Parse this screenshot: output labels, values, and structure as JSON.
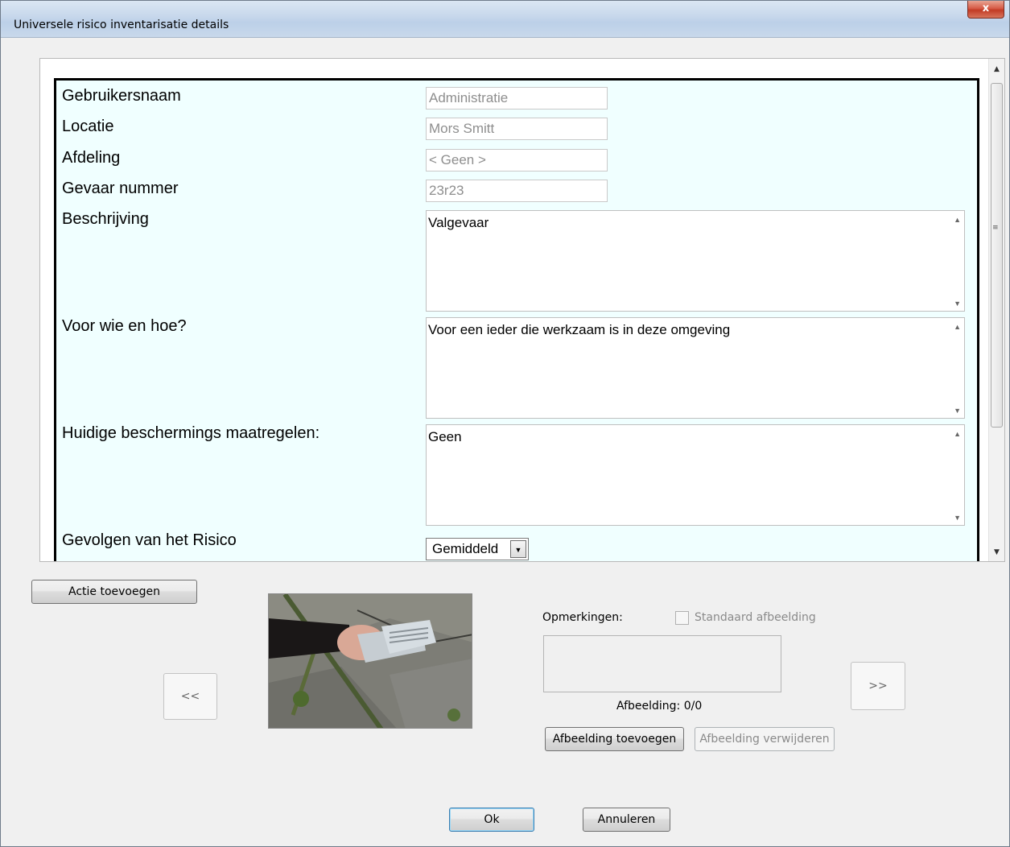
{
  "window": {
    "title": "Universele risico inventarisatie details",
    "close_label": "x"
  },
  "form": {
    "fields": [
      {
        "label": "Gebruikersnaam",
        "value": "Administratie"
      },
      {
        "label": "Locatie",
        "value": "Mors Smitt"
      },
      {
        "label": "Afdeling",
        "value": "< Geen >"
      },
      {
        "label": "Gevaar nummer",
        "value": "23r23"
      }
    ],
    "memos": [
      {
        "label": "Beschrijving",
        "value": "Valgevaar"
      },
      {
        "label": "Voor wie en hoe?",
        "value": "Voor een ieder die werkzaam is in deze omgeving"
      },
      {
        "label": "Huidige beschermings maatregelen:",
        "value": "Geen"
      }
    ],
    "gevolgen": {
      "label": "Gevolgen van het Risico",
      "selected": "Gemiddeld"
    }
  },
  "actions": {
    "add_action": "Actie toevoegen",
    "prev": "<<",
    "next": ">>",
    "remarks_label": "Opmerkingen:",
    "standard_image_label": "Standaard afbeelding",
    "image_counter": "Afbeelding: 0/0",
    "add_image": "Afbeelding toevoegen",
    "remove_image": "Afbeelding verwijderen",
    "ok": "Ok",
    "cancel": "Annuleren"
  },
  "icons": {
    "scroll_up": "scroll-up-arrow",
    "scroll_down": "scroll-down-arrow",
    "dropdown": "chevron-down-icon"
  }
}
